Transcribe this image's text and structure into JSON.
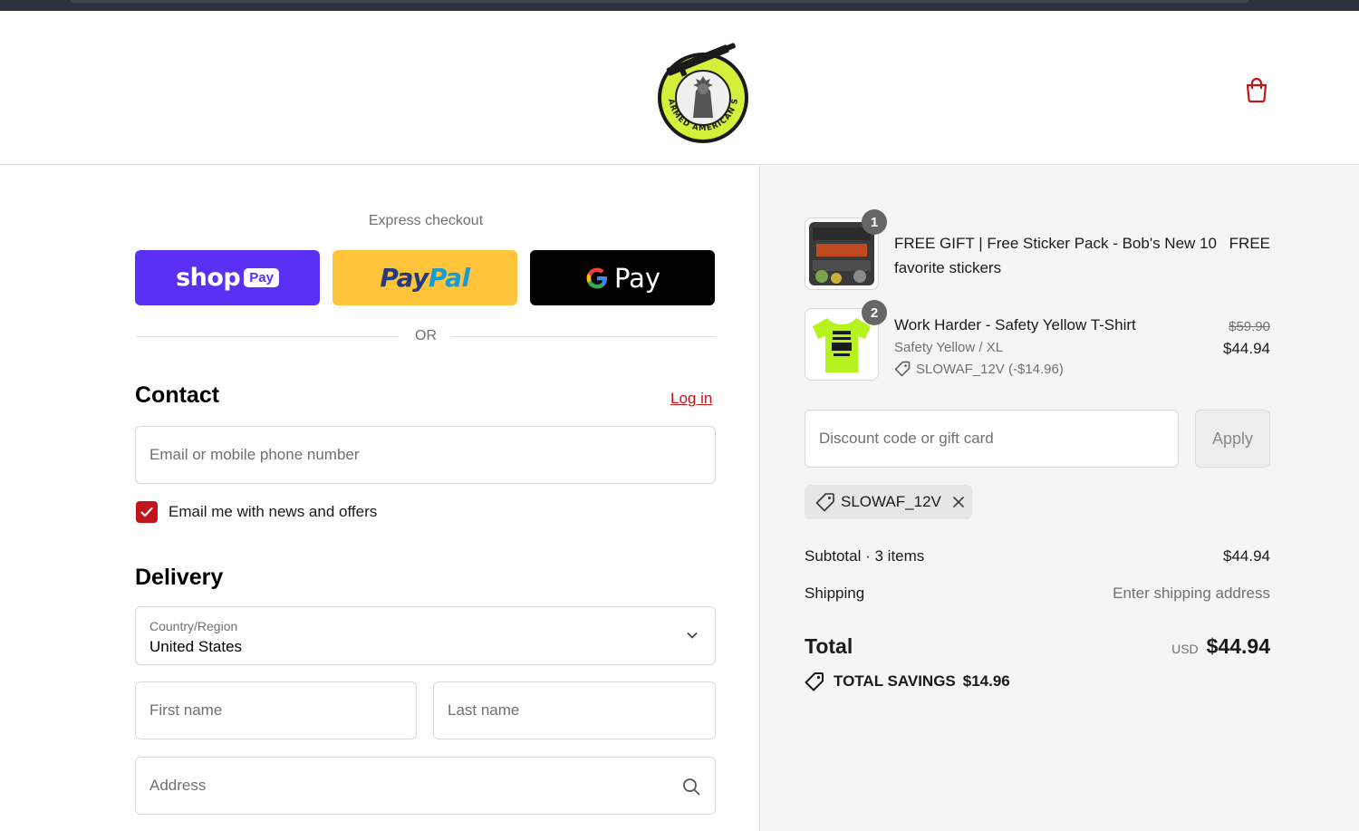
{
  "brand": {
    "logo_text": "ARMED AMERICAN SUPPLY"
  },
  "express": {
    "title": "Express checkout",
    "shop_label": "shop",
    "shop_pay_tag": "Pay",
    "paypal_part1": "Pay",
    "paypal_part2": "Pal",
    "gpay_label": "Pay",
    "or_label": "OR"
  },
  "contact": {
    "title": "Contact",
    "login_label": "Log in",
    "email_placeholder": "Email or mobile phone number",
    "newsletter_label": "Email me with news and offers",
    "newsletter_checked": true
  },
  "delivery": {
    "title": "Delivery",
    "country_label": "Country/Region",
    "country_value": "United States",
    "first_name_placeholder": "First name",
    "last_name_placeholder": "Last name",
    "address_placeholder": "Address"
  },
  "cart": {
    "items": [
      {
        "quantity": "1",
        "title_line1": "FREE GIFT | Free Sticker Pack - Bob's New 10",
        "title_line2": "favorite stickers",
        "price": "FREE"
      },
      {
        "quantity": "2",
        "title": "Work Harder - Safety Yellow T-Shirt",
        "variant": "Safety Yellow / XL",
        "discount": "SLOWAF_12V (-$14.96)",
        "original_price": "$59.90",
        "price": "$44.94"
      }
    ],
    "discount_placeholder": "Discount code or gift card",
    "apply_label": "Apply",
    "applied_code": "SLOWAF_12V"
  },
  "summary": {
    "subtotal_label": "Subtotal · 3 items",
    "subtotal_value": "$44.94",
    "shipping_label": "Shipping",
    "shipping_value": "Enter shipping address",
    "total_label": "Total",
    "currency": "USD",
    "total_value": "$44.94",
    "savings_label": "TOTAL SAVINGS",
    "savings_value": "$14.96"
  },
  "colors": {
    "accent": "#c4141b",
    "shop_pay": "#5a31f4",
    "paypal": "#ffc439",
    "logo_yellow": "#d4f03a"
  }
}
